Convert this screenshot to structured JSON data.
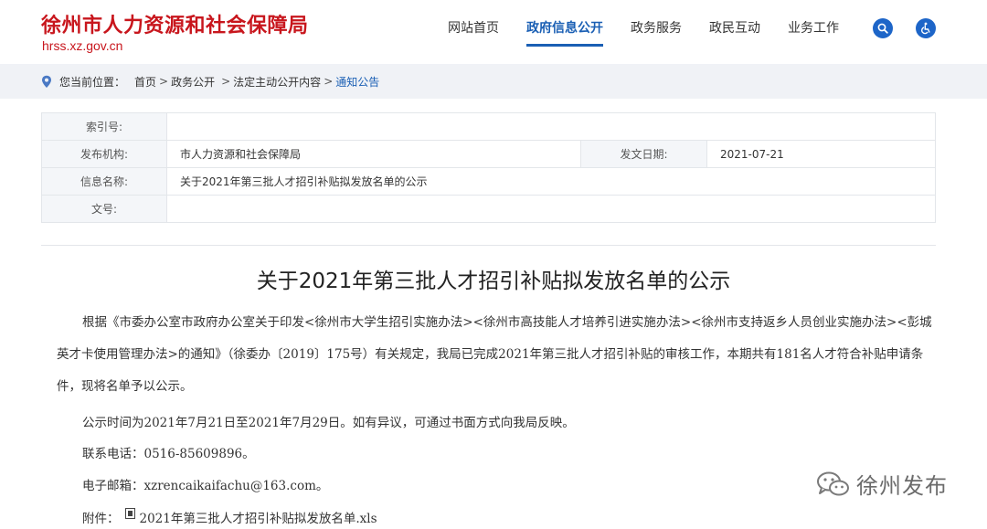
{
  "site": {
    "title": "徐州市人力资源和社会保障局",
    "domain": "hrss.xz.gov.cn"
  },
  "nav": {
    "items": [
      {
        "label": "网站首页",
        "active": false
      },
      {
        "label": "政府信息公开",
        "active": true
      },
      {
        "label": "政务服务",
        "active": false
      },
      {
        "label": "政民互动",
        "active": false
      },
      {
        "label": "业务工作",
        "active": false
      }
    ]
  },
  "breadcrumb": {
    "label": "您当前位置：",
    "items": [
      "首页",
      "政务公开",
      "法定主动公开内容",
      "通知公告"
    ]
  },
  "meta": {
    "index_label": "索引号:",
    "index_value": "",
    "publisher_label": "发布机构:",
    "publisher_value": "市人力资源和社会保障局",
    "date_label": "发文日期:",
    "date_value": "2021-07-21",
    "name_label": "信息名称:",
    "name_value": "关于2021年第三批人才招引补贴拟发放名单的公示",
    "docno_label": "文号:",
    "docno_value": ""
  },
  "article": {
    "title": "关于2021年第三批人才招引补贴拟发放名单的公示",
    "para1": "根据《市委办公室市政府办公室关于印发<徐州市大学生招引实施办法><徐州市高技能人才培养引进实施办法><徐州市支持返乡人员创业实施办法><彭城英才卡使用管理办法>的通知》（徐委办〔2019〕175号）有关规定，我局已完成2021年第三批人才招引补贴的审核工作，本期共有181名人才符合补贴申请条件，现将名单予以公示。",
    "para2": "公示时间为2021年7月21日至2021年7月29日。如有异议，可通过书面方式向我局反映。",
    "phone": "联系电话：0516-85609896。",
    "email": "电子邮箱：xzrencaikaifachu@163.com。",
    "attach_label": "附件：",
    "attach_file": "2021年第三批人才招引补贴拟发放名单.xls"
  },
  "watermark": {
    "text": "徐州发布"
  },
  "colors": {
    "brand_red": "#c8161d",
    "accent_blue": "#1a5fb4",
    "breadcrumb_bg": "#f0f2f6"
  }
}
